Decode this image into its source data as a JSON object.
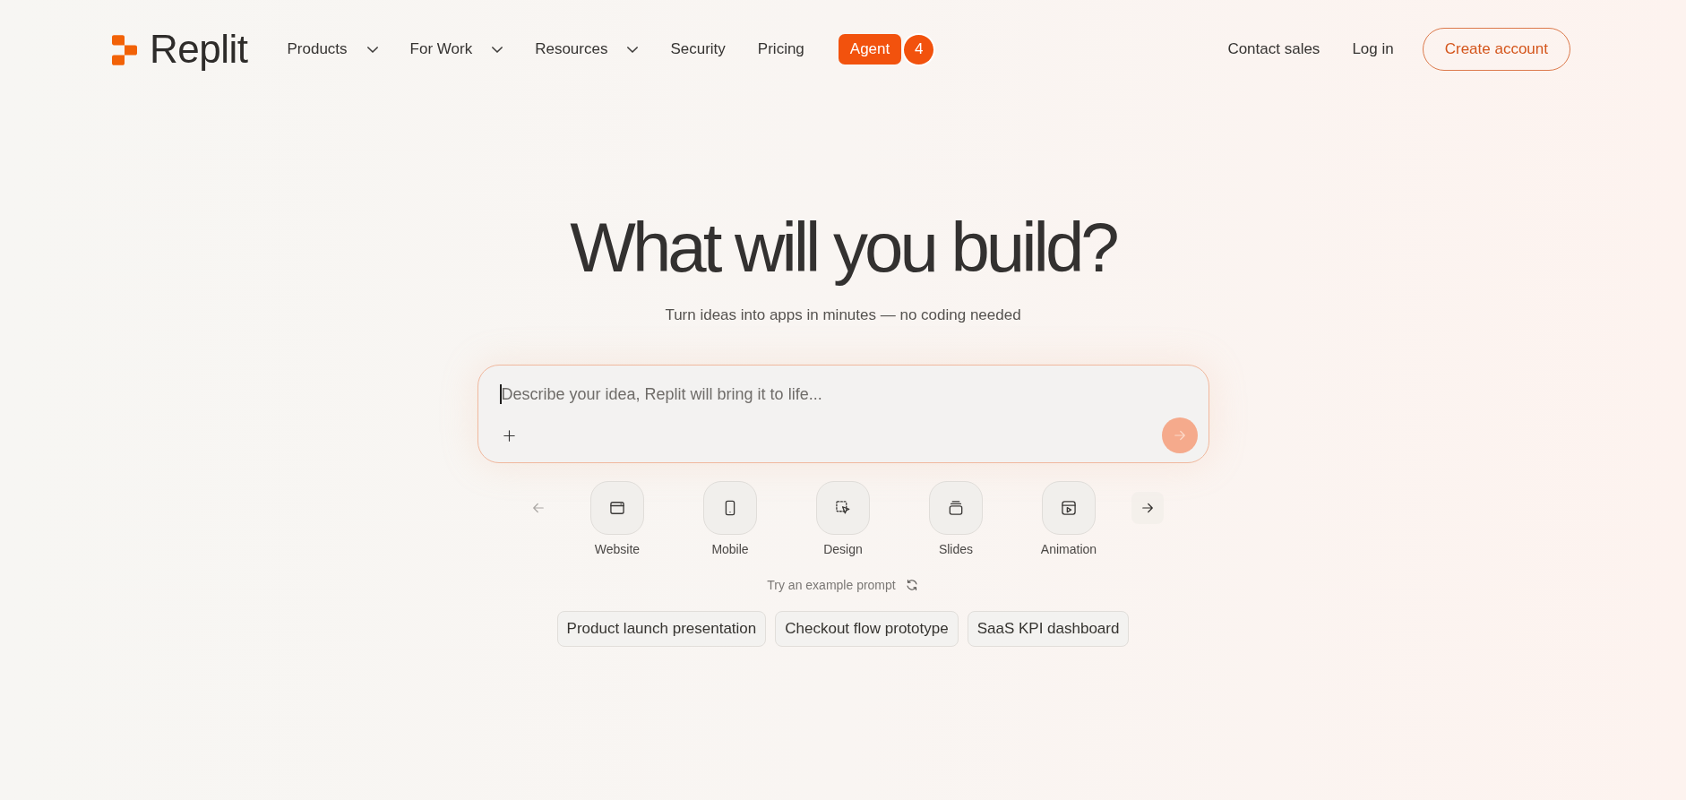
{
  "header": {
    "brand": "Replit",
    "nav": [
      {
        "label": "Products",
        "dropdown": true
      },
      {
        "label": "For Work",
        "dropdown": true
      },
      {
        "label": "Resources",
        "dropdown": true
      },
      {
        "label": "Security",
        "dropdown": false
      },
      {
        "label": "Pricing",
        "dropdown": false
      }
    ],
    "agent": {
      "label": "Agent",
      "badge": "4"
    },
    "actions": [
      {
        "label": "Contact sales",
        "kind": "link"
      },
      {
        "label": "Log in",
        "kind": "link"
      },
      {
        "label": "Create account",
        "kind": "outline"
      }
    ]
  },
  "hero": {
    "title": "What will you build?",
    "subtitle": "Turn ideas into apps in minutes — no coding needed"
  },
  "prompt": {
    "placeholder": "Describe your idea, Replit will bring it to life...",
    "focused": true,
    "send": {
      "disabled": true
    }
  },
  "categories": {
    "prev": {
      "disabled": true
    },
    "next": {
      "disabled": false
    },
    "items": [
      {
        "label": "Website",
        "kind": "website",
        "selected": false
      },
      {
        "label": "Mobile",
        "kind": "mobile",
        "selected": false
      },
      {
        "label": "Design",
        "kind": "design",
        "selected": false
      },
      {
        "label": "Slides",
        "kind": "slides",
        "selected": false
      },
      {
        "label": "Animation",
        "kind": "animation",
        "selected": false
      }
    ]
  },
  "examples": {
    "label": "Try an example prompt",
    "chips": [
      "Product launch presentation",
      "Checkout flow prototype",
      "SaaS KPI dashboard"
    ]
  }
}
